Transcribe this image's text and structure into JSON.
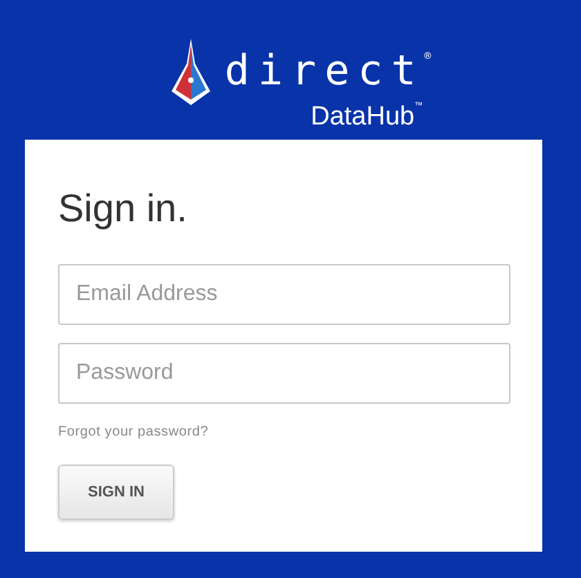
{
  "logo": {
    "wordmark": "direct$^{®}$",
    "subtitle": "DataHub$^{™}$"
  },
  "form": {
    "title": "Sign in.",
    "fields": [
      {
        "placeholder": "Email Address"
      },
      {
        "placeholder": "Password"
      }
    ],
    "forgot_link": "Forgot your password?",
    "button": "SIGN IN"
  }
}
